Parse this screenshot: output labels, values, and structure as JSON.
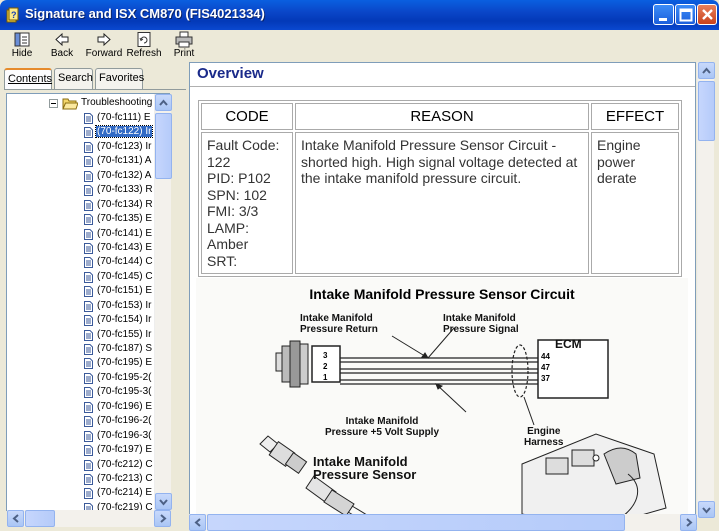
{
  "window": {
    "title": "Signature and ISX CM870 (FIS4021334)"
  },
  "toolbar": {
    "hide": "Hide",
    "back": "Back",
    "forward": "Forward",
    "refresh": "Refresh",
    "print": "Print"
  },
  "tabs": {
    "contents": "Contents",
    "search": "Search",
    "favorites": "Favorites"
  },
  "tree": {
    "root": "Troubleshooting",
    "items": [
      "(70-fc111) E",
      "(70-fc122) Ir",
      "(70-fc123) Ir",
      "(70-fc131) A",
      "(70-fc132) A",
      "(70-fc133) R",
      "(70-fc134) R",
      "(70-fc135) E",
      "(70-fc141) E",
      "(70-fc143) E",
      "(70-fc144) C",
      "(70-fc145) C",
      "(70-fc151) E",
      "(70-fc153) Ir",
      "(70-fc154) Ir",
      "(70-fc155) Ir",
      "(70-fc187) S",
      "(70-fc195) E",
      "(70-fc195-2(",
      "(70-fc195-3(",
      "(70-fc196) E",
      "(70-fc196-2(",
      "(70-fc196-3(",
      "(70-fc197) E",
      "(70-fc212) C",
      "(70-fc213) C",
      "(70-fc214) E",
      "(70-fc219) C"
    ],
    "selected_index": 1
  },
  "content": {
    "heading": "Overview",
    "table": {
      "headers": [
        "CODE",
        "REASON",
        "EFFECT"
      ],
      "code_lines": [
        "Fault Code:",
        "122",
        "PID: P102",
        "SPN: 102",
        "FMI: 3/3",
        "LAMP:",
        "Amber",
        "SRT:"
      ],
      "reason": "Intake Manifold Pressure Sensor Circuit - shorted high. High signal voltage detected at the intake manifold pressure circuit.",
      "effect_lines": [
        "Engine",
        "power",
        "derate"
      ]
    },
    "diagram": {
      "title": "Intake Manifold Pressure Sensor Circuit",
      "label_return_1": "Intake Manifold",
      "label_return_2": "Pressure Return",
      "label_signal_1": "Intake Manifold",
      "label_signal_2": "Pressure Signal",
      "label_supply_1": "Intake Manifold",
      "label_supply_2": "Pressure +5 Volt Supply",
      "label_ecm": "ECM",
      "label_harness_1": "Engine",
      "label_harness_2": "Harness",
      "label_sensor_1": "Intake Manifold",
      "label_sensor_2": "Pressure Sensor",
      "sensor_pins": [
        "3",
        "2",
        "1"
      ],
      "ecm_pins": [
        "44",
        "47",
        "37"
      ]
    }
  },
  "colors": {
    "titlebar": "#0a46c8",
    "heading": "#1a2a8a",
    "selection": "#316ac5"
  }
}
